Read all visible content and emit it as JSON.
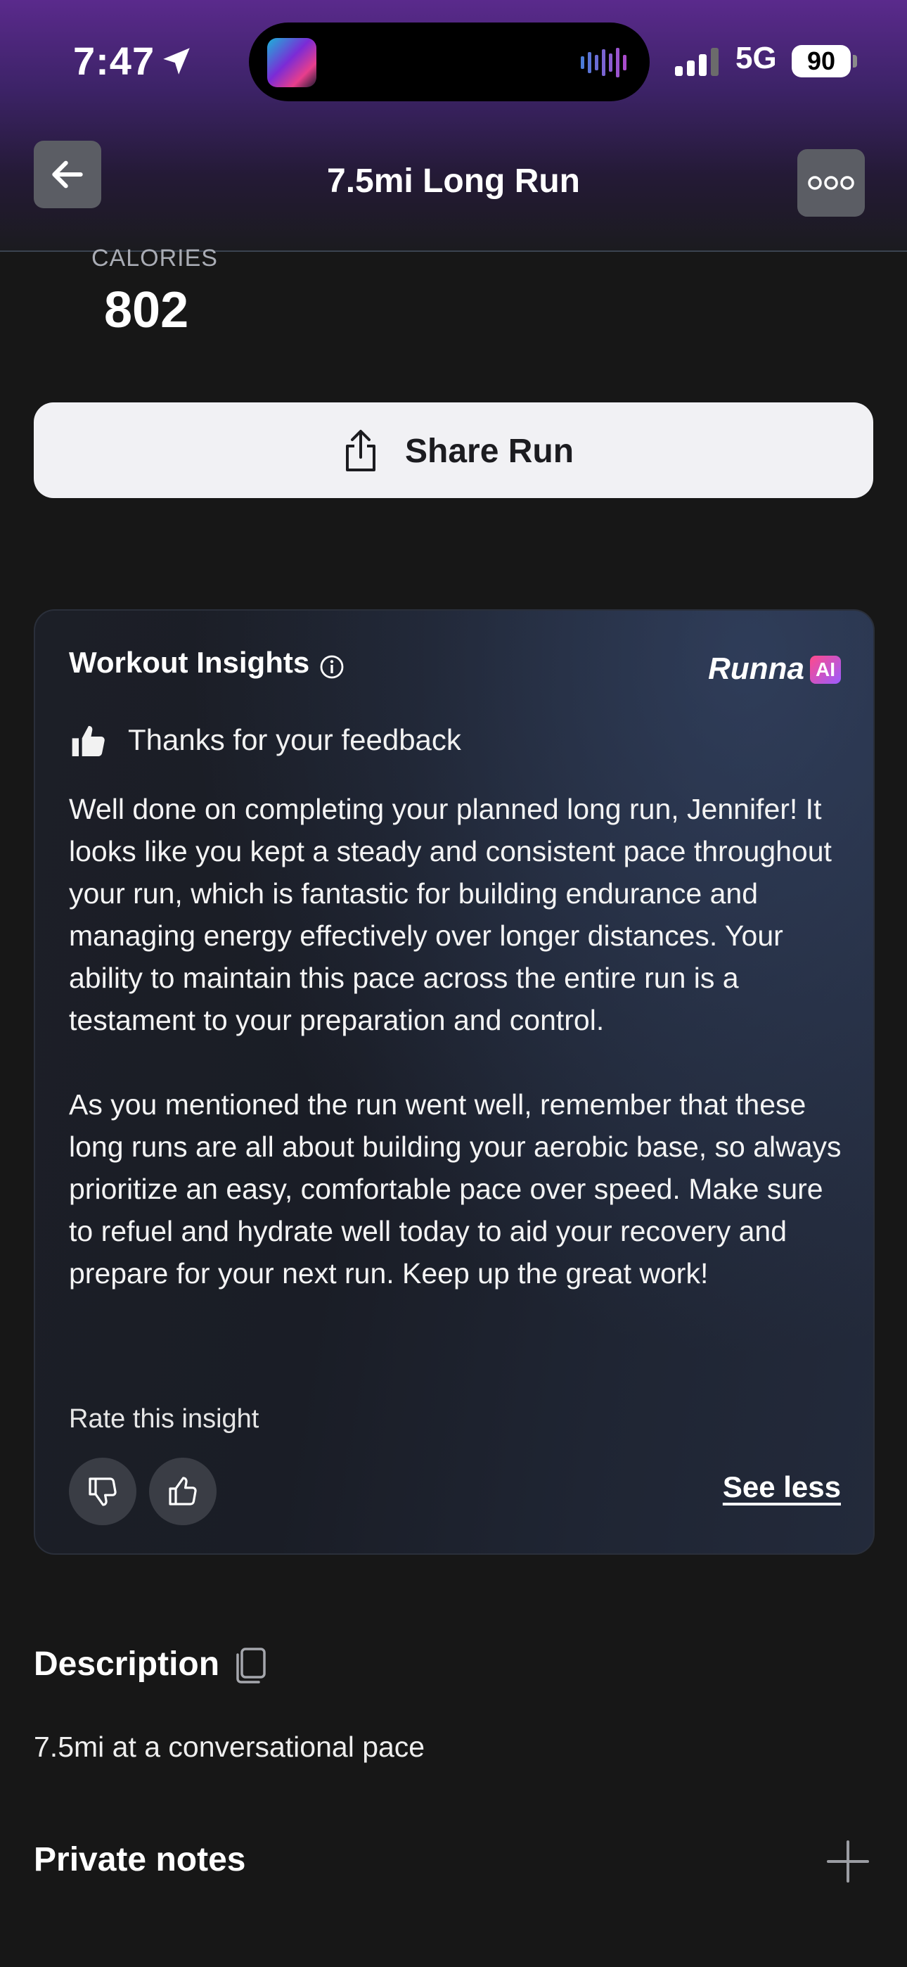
{
  "status_bar": {
    "time": "7:47",
    "network": "5G",
    "battery": "90"
  },
  "header": {
    "title": "7.5mi Long Run",
    "back_icon": "arrow-left-icon",
    "more_icon": "ellipsis-icon"
  },
  "stats": {
    "calories_label": "CALORIES",
    "calories_value": "802"
  },
  "share": {
    "label": "Share Run",
    "icon": "share-icon"
  },
  "insights": {
    "title": "Workout Insights",
    "brand": "Runna",
    "brand_badge": "AI",
    "feedback_text": "Thanks for your feedback",
    "paragraphs": [
      "Well done on completing your planned long run, Jennifer! It looks like you kept a steady and consistent pace throughout your run, which is fantastic for building endurance and managing energy effectively over longer distances. Your ability to maintain this pace across the entire run is a testament to your preparation and control.",
      "As you mentioned the run went well, remember that these long runs are all about building your aerobic base, so always prioritize an easy, comfortable pace over speed. Make sure to refuel and hydrate well today to aid your recovery and prepare for your next run. Keep up the great work!"
    ],
    "rate_label": "Rate this insight",
    "see_less": "See less"
  },
  "description": {
    "title": "Description",
    "text": "7.5mi at a conversational pace"
  },
  "notes": {
    "title": "Private notes"
  },
  "colors": {
    "background": "#171717",
    "header_top": "#5a2a8c",
    "button_light": "#f1f1f4",
    "brand_gradient_start": "#ff4a8a",
    "brand_gradient_end": "#9b5cff"
  }
}
